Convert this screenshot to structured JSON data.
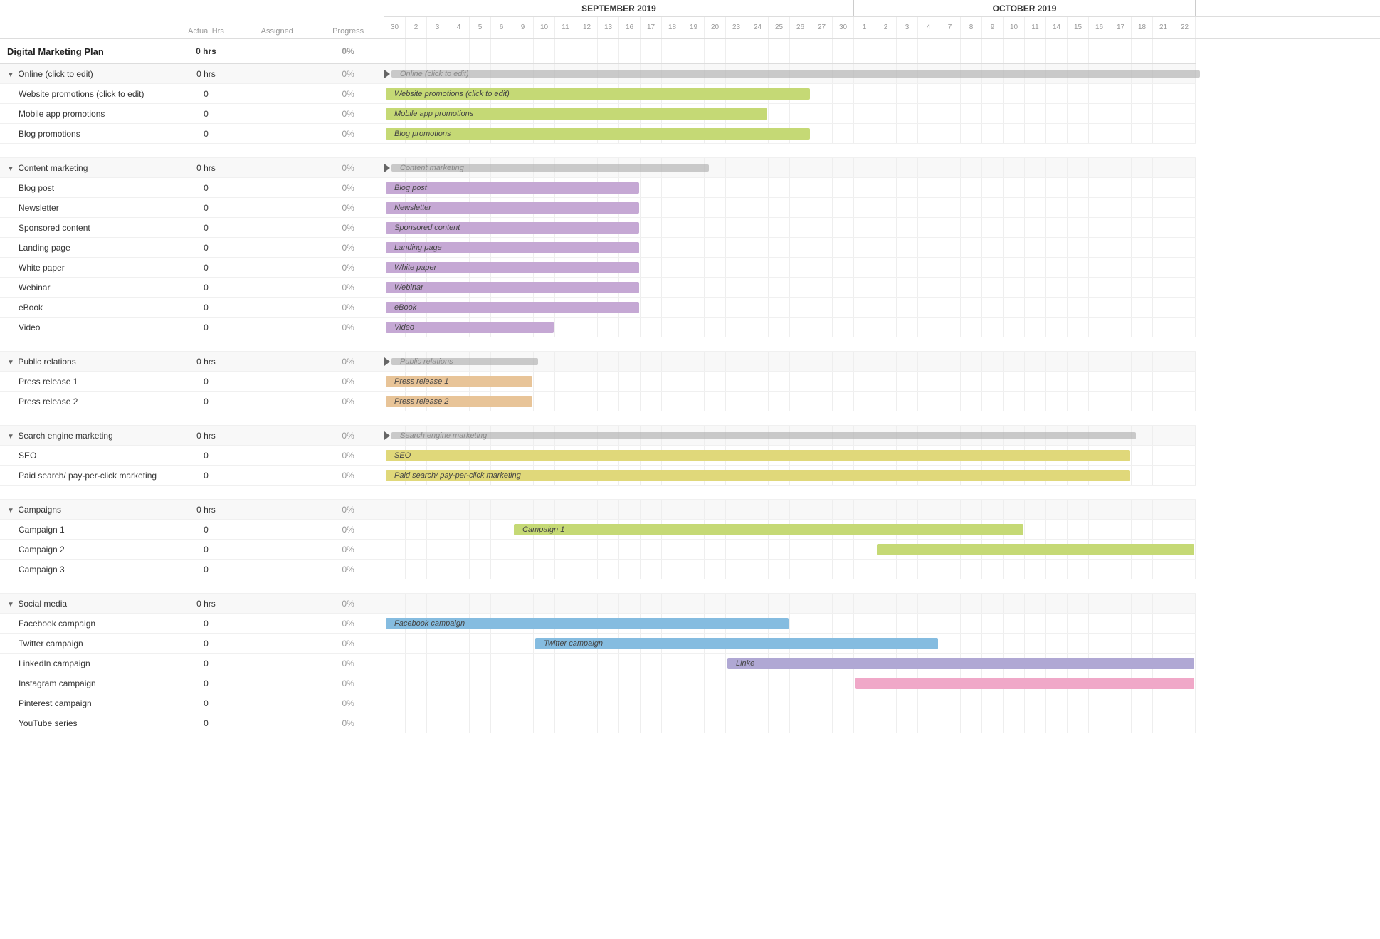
{
  "header": {
    "col_name": "",
    "col_actual": "Actual Hrs",
    "col_assigned": "Assigned",
    "col_progress": "Progress"
  },
  "months": [
    {
      "label": "SEPTEMBER 2019",
      "days": [
        30,
        2,
        3,
        4,
        5,
        6,
        9,
        10,
        11,
        12,
        13,
        16,
        17,
        18,
        19,
        20,
        23,
        24,
        25,
        26,
        27,
        30
      ]
    },
    {
      "label": "OCTOBER 2019",
      "days": [
        1,
        2,
        3,
        4,
        7,
        8,
        9,
        10,
        11,
        14,
        15,
        16,
        17,
        18,
        21,
        22
      ]
    }
  ],
  "rows": [
    {
      "type": "group",
      "name": "Digital Marketing Plan",
      "actual": "0 hrs",
      "assigned": "",
      "progress": "0%"
    },
    {
      "type": "section",
      "name": "Online (click to edit)",
      "actual": "0 hrs",
      "assigned": "",
      "progress": "0%",
      "collapsed": false
    },
    {
      "type": "task",
      "name": "Website promotions (click to edit)",
      "actual": "0",
      "assigned": "",
      "progress": "0%"
    },
    {
      "type": "task",
      "name": "Mobile app promotions",
      "actual": "0",
      "assigned": "",
      "progress": "0%"
    },
    {
      "type": "task",
      "name": "Blog promotions",
      "actual": "0",
      "assigned": "",
      "progress": "0%"
    },
    {
      "type": "spacer"
    },
    {
      "type": "section",
      "name": "Content marketing",
      "actual": "0 hrs",
      "assigned": "",
      "progress": "0%",
      "collapsed": false
    },
    {
      "type": "task",
      "name": "Blog post",
      "actual": "0",
      "assigned": "",
      "progress": "0%"
    },
    {
      "type": "task",
      "name": "Newsletter",
      "actual": "0",
      "assigned": "",
      "progress": "0%"
    },
    {
      "type": "task",
      "name": "Sponsored content",
      "actual": "0",
      "assigned": "",
      "progress": "0%"
    },
    {
      "type": "task",
      "name": "Landing page",
      "actual": "0",
      "assigned": "",
      "progress": "0%"
    },
    {
      "type": "task",
      "name": "White paper",
      "actual": "0",
      "assigned": "",
      "progress": "0%"
    },
    {
      "type": "task",
      "name": "Webinar",
      "actual": "0",
      "assigned": "",
      "progress": "0%"
    },
    {
      "type": "task",
      "name": "eBook",
      "actual": "0",
      "assigned": "",
      "progress": "0%"
    },
    {
      "type": "task",
      "name": "Video",
      "actual": "0",
      "assigned": "",
      "progress": "0%"
    },
    {
      "type": "spacer"
    },
    {
      "type": "section",
      "name": "Public relations",
      "actual": "0 hrs",
      "assigned": "",
      "progress": "0%",
      "collapsed": false
    },
    {
      "type": "task",
      "name": "Press release 1",
      "actual": "0",
      "assigned": "",
      "progress": "0%"
    },
    {
      "type": "task",
      "name": "Press release 2",
      "actual": "0",
      "assigned": "",
      "progress": "0%"
    },
    {
      "type": "spacer"
    },
    {
      "type": "section",
      "name": "Search engine marketing",
      "actual": "0 hrs",
      "assigned": "",
      "progress": "0%",
      "collapsed": false
    },
    {
      "type": "task",
      "name": "SEO",
      "actual": "0",
      "assigned": "",
      "progress": "0%"
    },
    {
      "type": "task",
      "name": "Paid search/ pay-per-click marketing",
      "actual": "0",
      "assigned": "",
      "progress": "0%"
    },
    {
      "type": "spacer"
    },
    {
      "type": "section",
      "name": "Campaigns",
      "actual": "0 hrs",
      "assigned": "",
      "progress": "0%",
      "collapsed": false
    },
    {
      "type": "task",
      "name": "Campaign 1",
      "actual": "0",
      "assigned": "",
      "progress": "0%"
    },
    {
      "type": "task",
      "name": "Campaign 2",
      "actual": "0",
      "assigned": "",
      "progress": "0%"
    },
    {
      "type": "task",
      "name": "Campaign 3",
      "actual": "0",
      "assigned": "",
      "progress": "0%"
    },
    {
      "type": "spacer"
    },
    {
      "type": "section",
      "name": "Social media",
      "actual": "0 hrs",
      "assigned": "",
      "progress": "0%",
      "collapsed": false
    },
    {
      "type": "task",
      "name": "Facebook campaign",
      "actual": "0",
      "assigned": "",
      "progress": "0%"
    },
    {
      "type": "task",
      "name": "Twitter campaign",
      "actual": "0",
      "assigned": "",
      "progress": "0%"
    },
    {
      "type": "task",
      "name": "LinkedIn campaign",
      "actual": "0",
      "assigned": "",
      "progress": "0%"
    },
    {
      "type": "task",
      "name": "Instagram campaign",
      "actual": "0",
      "assigned": "",
      "progress": "0%"
    },
    {
      "type": "task",
      "name": "Pinterest campaign",
      "actual": "0",
      "assigned": "",
      "progress": "0%"
    },
    {
      "type": "task",
      "name": "YouTube series",
      "actual": "0",
      "assigned": "",
      "progress": "0%"
    }
  ],
  "colors": {
    "accent": "#4a90d9",
    "gray": "#c8c8c8",
    "green": "#c5d975",
    "purple": "#c5a8d4",
    "orange": "#e8c498",
    "yellow": "#e0d87a",
    "blue": "#85bce0",
    "lavender": "#b0a8d4",
    "pink": "#f0a8c8"
  }
}
